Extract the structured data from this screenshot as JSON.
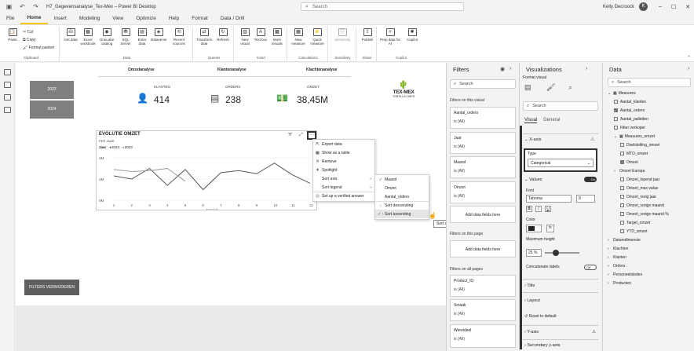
{
  "window": {
    "title": "H7_Gegevensanalyse_Tex-Mex – Power BI Desktop",
    "search_placeholder": "Search",
    "user": "Kelly Decroock"
  },
  "menu": [
    "File",
    "Home",
    "Insert",
    "Modeling",
    "View",
    "Optimize",
    "Help",
    "Format",
    "Data / Drill"
  ],
  "ribbon": {
    "clipboard": {
      "paste": "Paste",
      "cut": "Cut",
      "copy": "Copy",
      "format_painter": "Format painter",
      "label": "Clipboard"
    },
    "data": {
      "get_data": "Get data",
      "excel": "Excel workbook",
      "onelake": "OneLake catalog",
      "sql": "SQL Server",
      "enter": "Enter data",
      "dataverse": "Dataverse",
      "recent": "Recent sources",
      "label": "Data"
    },
    "queries": {
      "transform": "Transform data",
      "refresh": "Refresh",
      "label": "Queries"
    },
    "insert": {
      "new_visual": "New visual",
      "text_box": "Text box",
      "more_visuals": "More visuals",
      "label": "Insert"
    },
    "calculations": {
      "new_measure": "New measure",
      "quick_measure": "Quick measure",
      "label": "Calculations"
    },
    "sensitivity": {
      "sensitivity": "Sensitivity",
      "label": "Sensitivity"
    },
    "share": {
      "publish": "Publish",
      "label": "Share"
    },
    "copilot": {
      "prep": "Prep data for AI",
      "copilot": "Copilot",
      "label": "Copilot"
    }
  },
  "report": {
    "years": [
      "2022",
      "2024"
    ],
    "sections": [
      "Omzetanalyse",
      "Klantenanalyse",
      "Klachtenanalyse"
    ],
    "kpis": [
      {
        "label": "KLANTEN",
        "value": "414"
      },
      {
        "label": "ORDERS",
        "value": "238"
      },
      {
        "label": "OMZET",
        "value": "38,45M"
      }
    ],
    "logo": {
      "top": "TEX-MEX",
      "bottom": "TORTILLA CHIPS"
    },
    "filter_button": "FILTERS VERWIJDEREN",
    "more_options": "···"
  },
  "chart_data": {
    "type": "line",
    "title": "EVOLUTIE OMZET",
    "subtitle": "PER JAAR",
    "legend_title": "Jaar",
    "xlabel": "Maand",
    "x": [
      1,
      2,
      3,
      4,
      5,
      6,
      7,
      8,
      9,
      10,
      11,
      12
    ],
    "yticks": [
      "0M",
      "2M",
      "4M"
    ],
    "ylim": [
      0,
      4
    ],
    "series": [
      {
        "name": "2024",
        "color": "#555555",
        "values": [
          2.3,
          2.0,
          3.0,
          1.4,
          2.9,
          1.0,
          2.6,
          2.8,
          2.5,
          3.5,
          2.4,
          1.6
        ]
      },
      {
        "name": "2023",
        "color": "#9a9a9a",
        "values": [
          2.9,
          2.7,
          2.8,
          3.0,
          1.8,
          null,
          null,
          null,
          null,
          null,
          null,
          null
        ]
      }
    ],
    "legend": "top-left"
  },
  "context_menu": {
    "items": [
      {
        "label": "Export data",
        "icon": "⇱"
      },
      {
        "label": "Show as a table",
        "icon": "▦"
      },
      {
        "label": "Remove",
        "icon": "✕"
      },
      {
        "label": "Spotlight",
        "icon": "✦"
      },
      {
        "label": "Sort axis",
        "icon": "",
        "arrow": "›"
      },
      {
        "label": "Sort legend",
        "icon": "",
        "arrow": "›"
      },
      {
        "label": "Set up a verified answer",
        "icon": "◎"
      }
    ],
    "sub_items": [
      {
        "label": "Maand",
        "icon": "✓"
      },
      {
        "label": "Omzet",
        "icon": ""
      },
      {
        "label": "Aantal_orders",
        "icon": ""
      },
      {
        "label": "Sort descending",
        "icon": "↓"
      },
      {
        "label": "Sort ascending",
        "icon": "✓ ↑"
      }
    ],
    "tooltip": "Sort ascending"
  },
  "filters": {
    "title": "Filters",
    "search": "Search",
    "on_visual": "Filters on this visual",
    "visual_cards": [
      {
        "name": "Aantal_orders",
        "value": "is (All)"
      },
      {
        "name": "Jaar",
        "value": "is (All)"
      },
      {
        "name": "Maand",
        "value": "is (All)"
      },
      {
        "name": "Omzet",
        "value": "is (All)"
      }
    ],
    "add_here": "Add data fields here",
    "on_page": "Filters on this page",
    "on_all": "Filters on all pages",
    "all_cards": [
      {
        "name": "Product_ID",
        "value": "is (All)"
      },
      {
        "name": "Smaak",
        "value": "is (All)"
      },
      {
        "name": "Wereldeel",
        "value": "is (All)"
      }
    ]
  },
  "visualizations": {
    "title": "Visualizations",
    "format_visual": "Format visual",
    "search": "Search",
    "tabs": [
      "Visual",
      "General"
    ],
    "xaxis": "X-axis",
    "type_label": "Type",
    "type_value": "Categorical",
    "values": "Values",
    "font": "Font",
    "font_name": "Tahoma",
    "font_size": "9",
    "color": "Color",
    "max_height": "Maximum height",
    "max_height_value": "25 %",
    "concat": "Concatenate labels",
    "title_sec": "Title",
    "layout": "Layout",
    "reset": "Reset to default",
    "yaxis": "Y-axis",
    "secondary": "Secondary y-axis",
    "toggle_on": "On",
    "toggle_off": "Off"
  },
  "data_pane": {
    "title": "Data",
    "search": "Search",
    "tree": [
      {
        "label": "Measures",
        "level": 0,
        "expand": "⌄",
        "chk": false,
        "icon": true
      },
      {
        "label": "Aantal_klanten",
        "level": 1,
        "chk": false
      },
      {
        "label": "Aantal_orders",
        "level": 1,
        "chk": true
      },
      {
        "label": "Aantal_palletten",
        "level": 1,
        "chk": false
      },
      {
        "label": "Filter verkoper",
        "level": 1,
        "chk": false
      },
      {
        "label": "Measures_omzet",
        "level": 1,
        "expand": "⌄",
        "icon": true
      },
      {
        "label": "Doelstelling_omzet",
        "level": 2,
        "chk": false
      },
      {
        "label": "MTD_omzet",
        "level": 2,
        "chk": false
      },
      {
        "label": "Omzet",
        "level": 2,
        "chk": true
      },
      {
        "label": "Omzet Europa",
        "level": 1,
        "expand": "›"
      },
      {
        "label": "Omzet_lopend jaar",
        "level": 2,
        "chk": false
      },
      {
        "label": "Omzet_max value",
        "level": 2,
        "chk": false
      },
      {
        "label": "Omzet_vorig jaar",
        "level": 2,
        "chk": false
      },
      {
        "label": "Omzet_vorige maand",
        "level": 2,
        "chk": false
      },
      {
        "label": "Omzet_vorige maand %",
        "level": 2,
        "chk": false
      },
      {
        "label": "Target_omzet",
        "level": 2,
        "chk": false
      },
      {
        "label": "YTD_omzet",
        "level": 2,
        "chk": false
      },
      {
        "label": "Datumdimensie",
        "level": 0,
        "expand": "›"
      },
      {
        "label": "Klachten",
        "level": 0,
        "expand": "›"
      },
      {
        "label": "Klanten",
        "level": 0,
        "expand": "›"
      },
      {
        "label": "Orders",
        "level": 0,
        "expand": "›"
      },
      {
        "label": "Personeelsleden",
        "level": 0,
        "expand": "›"
      },
      {
        "label": "Producten",
        "level": 0,
        "expand": "›"
      }
    ]
  }
}
